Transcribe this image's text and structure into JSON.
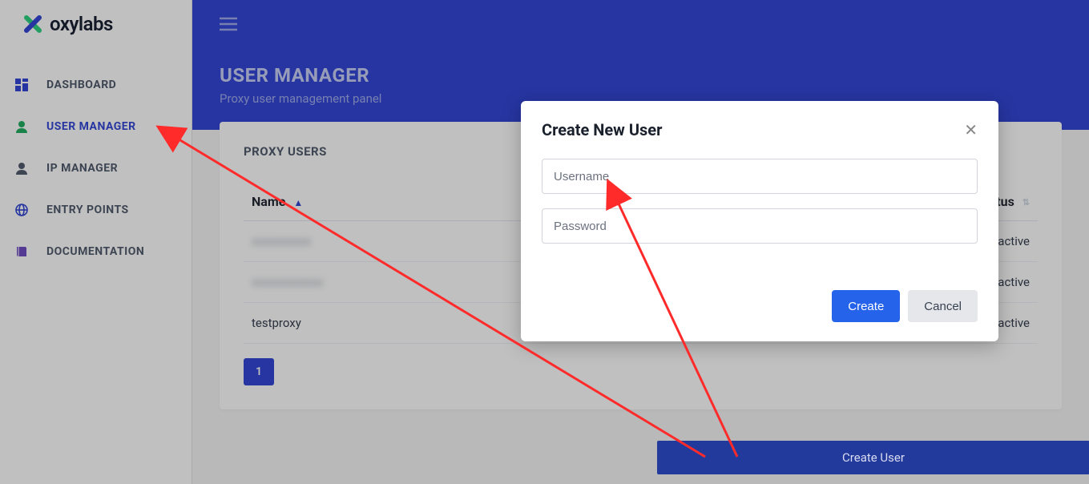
{
  "brand": {
    "name": "oxylabs"
  },
  "sidebar": {
    "items": [
      {
        "label": "DASHBOARD"
      },
      {
        "label": "USER MANAGER"
      },
      {
        "label": "IP MANAGER"
      },
      {
        "label": "ENTRY POINTS"
      },
      {
        "label": "DOCUMENTATION"
      }
    ]
  },
  "page": {
    "title": "USER MANAGER",
    "subtitle": "Proxy user management panel"
  },
  "card": {
    "title": "PROXY USERS",
    "headers": {
      "name": "Name",
      "status": "Status"
    },
    "rows": [
      {
        "name": "xxxxxxxxxx",
        "status": "active",
        "blurred": true
      },
      {
        "name": "xxxxxxxxxxxx",
        "status": "active",
        "blurred": true
      },
      {
        "name": "testproxy",
        "status": "active",
        "blurred": false
      }
    ],
    "page_number": "1"
  },
  "create_user_button": "Create User",
  "modal": {
    "title": "Create New User",
    "username_placeholder": "Username",
    "password_placeholder": "Password",
    "create": "Create",
    "cancel": "Cancel"
  },
  "colors": {
    "brand_blue": "#2a3fd4",
    "accent_green": "#26d07c",
    "status_green": "#38a169"
  }
}
